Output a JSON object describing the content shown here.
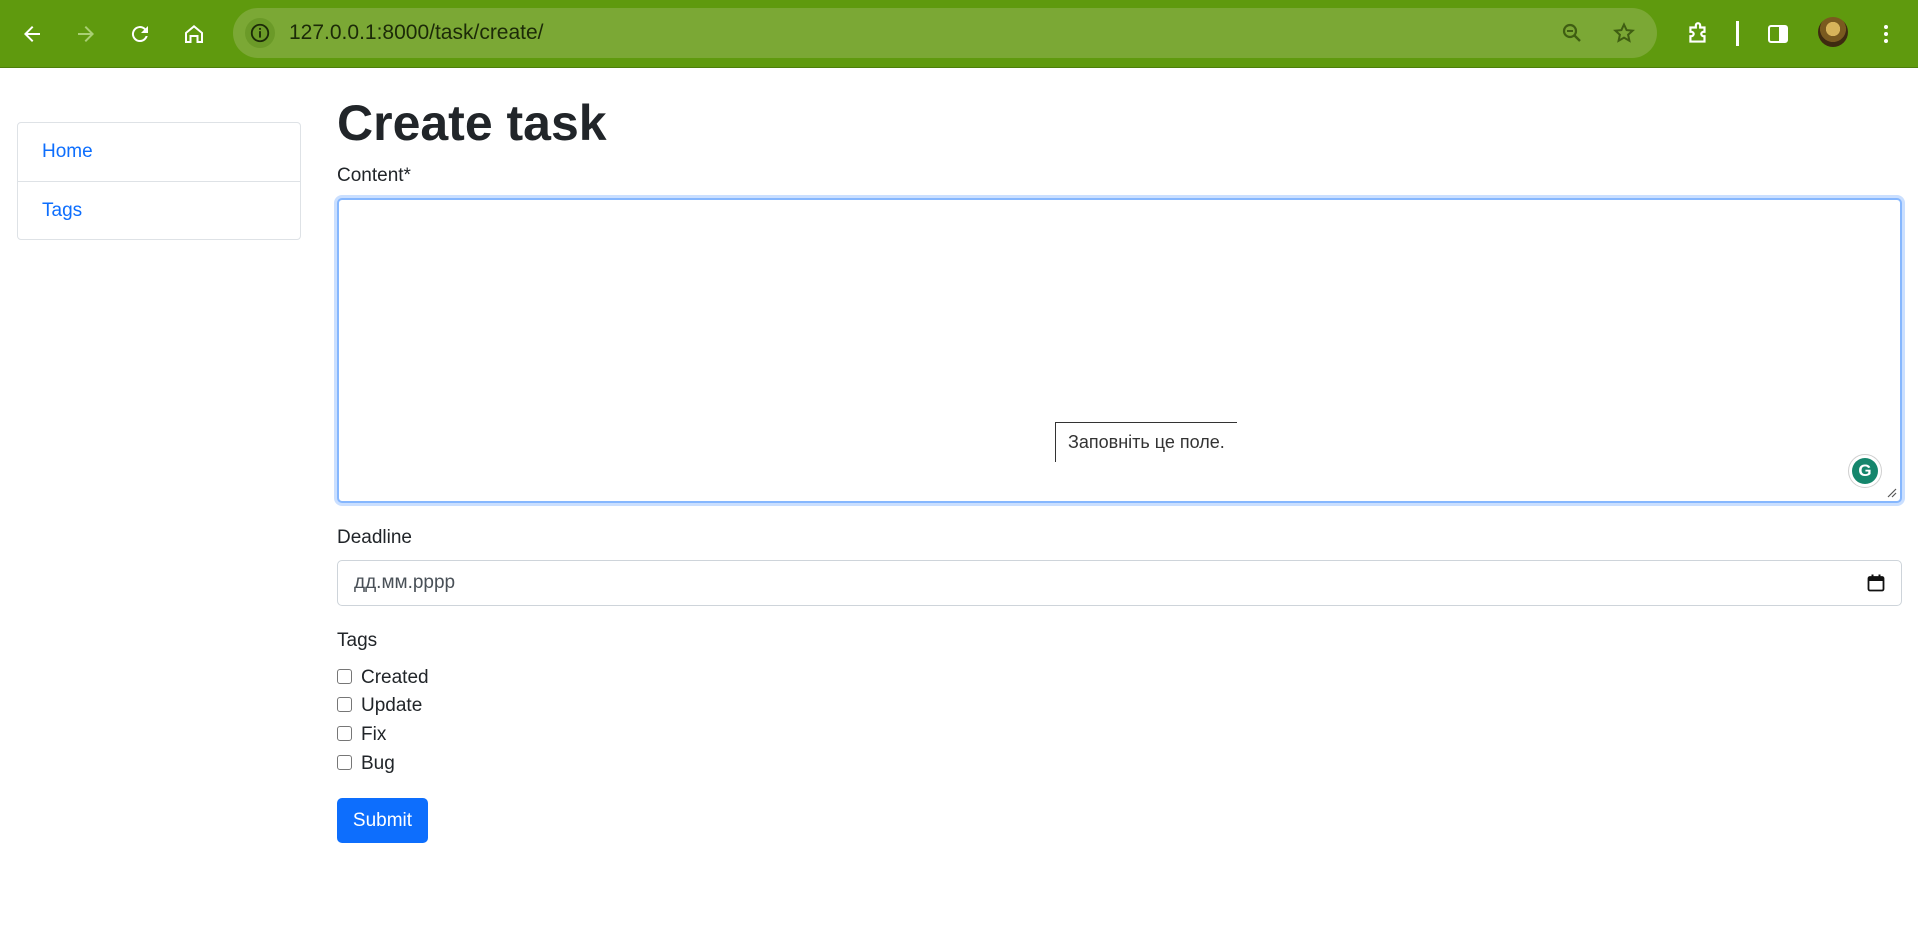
{
  "browser": {
    "url": "127.0.0.1:8000/task/create/"
  },
  "sidebar": {
    "items": [
      {
        "label": "Home"
      },
      {
        "label": "Tags"
      }
    ]
  },
  "form": {
    "title": "Create task",
    "content_label": "Content*",
    "content_value": "",
    "validation_tooltip": "Заповніть це поле.",
    "deadline_label": "Deadline",
    "deadline_placeholder": "дд.мм.рррр",
    "tags_label": "Tags",
    "tags": [
      {
        "label": "Created",
        "checked": false
      },
      {
        "label": "Update",
        "checked": false
      },
      {
        "label": "Fix",
        "checked": false
      },
      {
        "label": "Bug",
        "checked": false
      }
    ],
    "submit_label": "Submit"
  },
  "colors": {
    "toolbar": "#5f9a0e",
    "omnibox": "#7ba835",
    "link": "#0d6efd",
    "primary_button": "#0d6efd",
    "focus_border": "#86b7fe"
  },
  "icons": [
    "back-icon",
    "forward-icon",
    "reload-icon",
    "home-icon",
    "site-info-icon",
    "zoom-icon",
    "bookmark-star-icon",
    "extensions-icon",
    "side-panel-icon",
    "menu-icon",
    "calendar-icon",
    "grammarly-icon"
  ]
}
